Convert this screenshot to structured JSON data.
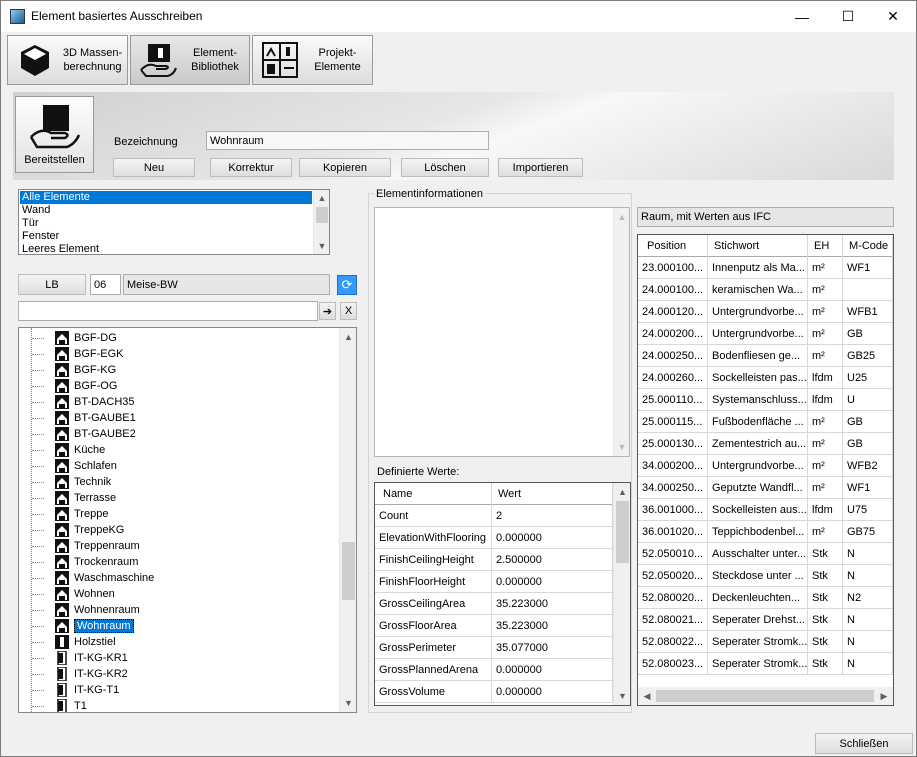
{
  "window": {
    "title": "Element basiertes Ausschreiben",
    "minimize": "—",
    "maximize": "☐",
    "close": "✕"
  },
  "modules": [
    {
      "label": "3D Massen-\nberechnung"
    },
    {
      "label": "Element-\nBibliothek"
    },
    {
      "label": "Projekt-\nElemente"
    }
  ],
  "ribbon": {
    "provide_label": "Bereitstellen",
    "designation_label": "Bezeichnung",
    "designation_value": "Wohnraum",
    "buttons": [
      "Neu",
      "Korrektur",
      "Kopieren",
      "Löschen",
      "Importieren"
    ]
  },
  "categories": {
    "items": [
      "Alle Elemente",
      "Wand",
      "Tür",
      "Fenster",
      "Leeres Element"
    ],
    "selected": 0
  },
  "lb": {
    "label": "LB",
    "number": "06",
    "name": "Meise-BW"
  },
  "search": {
    "value": "",
    "go": "➔",
    "clear": "X"
  },
  "tree": {
    "items": [
      "BGF-DG",
      "BGF-EGK",
      "BGF-KG",
      "BGF-OG",
      "BT-DACH35",
      "BT-GAUBE1",
      "BT-GAUBE2",
      "Küche",
      "Schlafen",
      "Technik",
      "Terrasse",
      "Treppe",
      "TreppeKG",
      "Treppenraum",
      "Trockenraum",
      "Waschmaschine",
      "Wohnen",
      "Wohnenraum",
      "Wohnraum",
      "Holzstiel",
      "IT-KG-KR1",
      "IT-KG-KR2",
      "IT-KG-T1",
      "T1"
    ],
    "selected": 18
  },
  "element_info": {
    "label": "Elementinformationen",
    "ifc_label": "Raum, mit Werten aus IFC"
  },
  "defined_values": {
    "label": "Definierte Werte:",
    "headers": [
      "Name",
      "Wert"
    ],
    "rows": [
      [
        "Count",
        "2"
      ],
      [
        "ElevationWithFlooring",
        "0.000000"
      ],
      [
        "FinishCeilingHeight",
        "2.500000"
      ],
      [
        "FinishFloorHeight",
        "0.000000"
      ],
      [
        "GrossCeilingArea",
        "35.223000"
      ],
      [
        "GrossFloorArea",
        "35.223000"
      ],
      [
        "GrossPerimeter",
        "35.077000"
      ],
      [
        "GrossPlannedArena",
        "0.000000"
      ],
      [
        "GrossVolume",
        "0.000000"
      ]
    ]
  },
  "positions": {
    "headers": [
      "Position",
      "Stichwort",
      "EH",
      "M-Code"
    ],
    "rows": [
      [
        "23.000100...",
        "Innenputz als Ma...",
        "m²",
        "WF1"
      ],
      [
        "24.000100...",
        "keramischen Wa...",
        "m²",
        ""
      ],
      [
        "24.000120...",
        "Untergrundvorbe...",
        "m²",
        "WFB1"
      ],
      [
        "24.000200...",
        "Untergrundvorbe...",
        "m²",
        "GB"
      ],
      [
        "24.000250...",
        "Bodenfliesen ge...",
        "m²",
        "GB25"
      ],
      [
        "24.000260...",
        "Sockelleisten pas...",
        "lfdm",
        "U25"
      ],
      [
        "25.000110...",
        "Systemanschluss...",
        "lfdm",
        "U"
      ],
      [
        "25.000115...",
        "Fußbodenfläche ...",
        "m²",
        "GB"
      ],
      [
        "25.000130...",
        "Zementestrich au...",
        "m²",
        "GB"
      ],
      [
        "34.000200...",
        "Untergrundvorbe...",
        "m²",
        "WFB2"
      ],
      [
        "34.000250...",
        "Geputzte Wandfl...",
        "m²",
        "WF1"
      ],
      [
        "36.001000...",
        "Sockelleisten aus...",
        "lfdm",
        "U75"
      ],
      [
        "36.001020...",
        "Teppichbodenbel...",
        "m²",
        "GB75"
      ],
      [
        "52.050010...",
        "Ausschalter unter...",
        "Stk",
        "N"
      ],
      [
        "52.050020...",
        "Steckdose unter ...",
        "Stk",
        "N"
      ],
      [
        "52.080020...",
        "Deckenleuchten...",
        "Stk",
        "N2"
      ],
      [
        "52.080021...",
        "Seperater Drehst...",
        "Stk",
        "N"
      ],
      [
        "52.080022...",
        "Seperater Stromk...",
        "Stk",
        "N"
      ],
      [
        "52.080023...",
        "Seperater Stromk...",
        "Stk",
        "N"
      ]
    ]
  },
  "footer": {
    "close": "Schließen"
  },
  "colors": {
    "selection": "#0078d7",
    "accent_icon": "#3399ff"
  }
}
